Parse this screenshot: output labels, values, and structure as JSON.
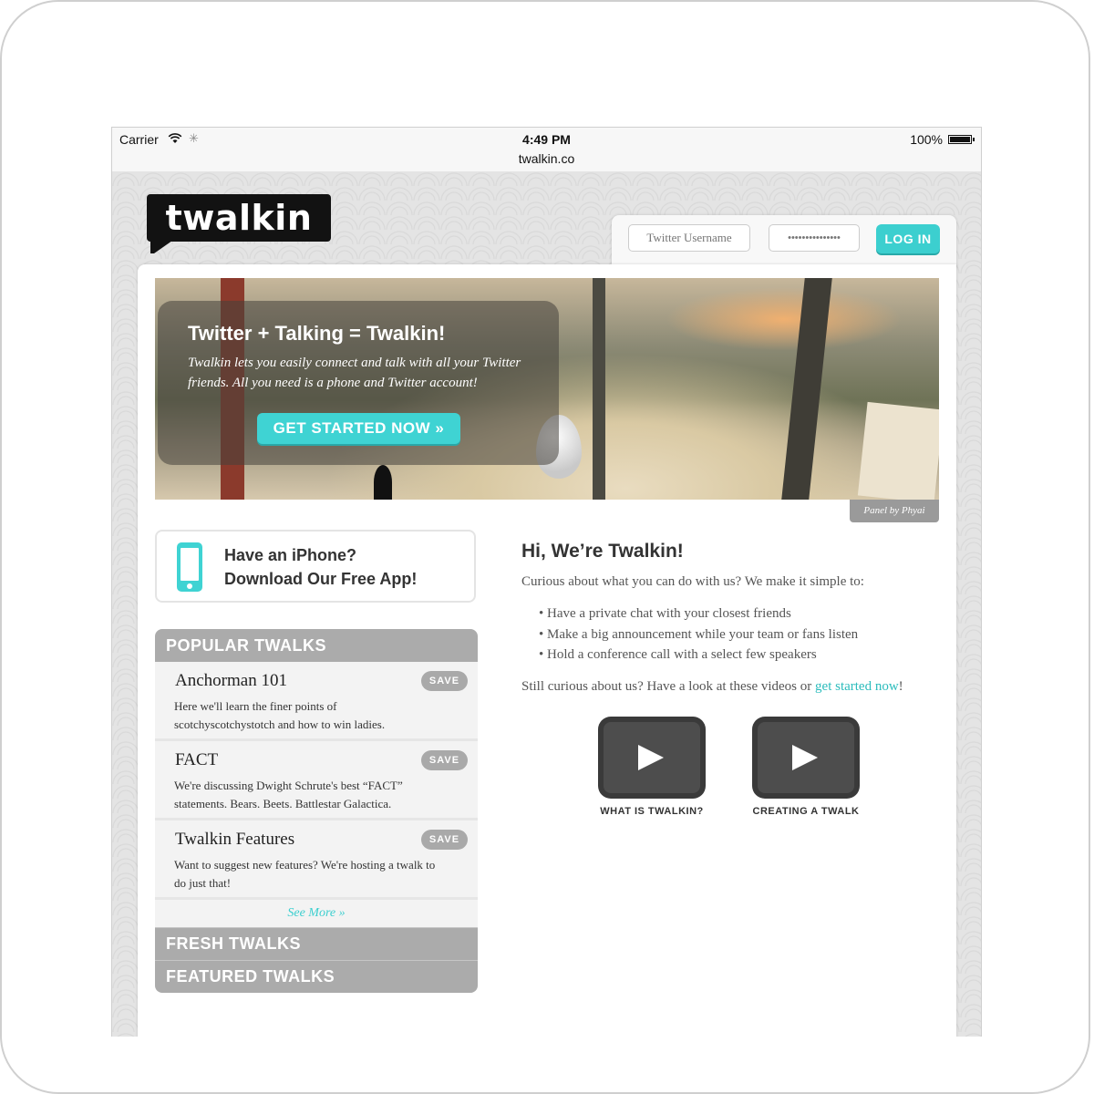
{
  "statusbar": {
    "carrier": "Carrier",
    "time": "4:49 PM",
    "url": "twalkin.co",
    "battery": "100%"
  },
  "site": {
    "logo": "twalkin",
    "login": {
      "username_placeholder": "Twitter Username",
      "password_mask": "•••••••••••••••",
      "button": "LOG IN"
    },
    "hero": {
      "title": "Twitter + Talking = Twalkin!",
      "text": "Twalkin lets you easily connect and talk with all your Twitter friends. All you need is a phone and Twitter account!",
      "button": "GET STARTED NOW »",
      "credit": "Panel by Phyai"
    },
    "app_promo": {
      "line1": "Have an iPhone?",
      "line2": "Download Our Free App!"
    },
    "popular": {
      "heading": "POPULAR TWALKS",
      "items": [
        {
          "title": "Anchorman 101",
          "desc": "Here we'll learn the finer points of scotchyscotchystotch and how to win ladies.",
          "save": "SAVE"
        },
        {
          "title": "FACT",
          "desc": "We're discussing Dwight Schrute's best “FACT” statements. Bears. Beets. Battlestar Galactica.",
          "save": "SAVE"
        },
        {
          "title": "Twalkin Features",
          "desc": "Want to suggest new features? We're hosting a twalk to do just that!",
          "save": "SAVE"
        }
      ],
      "see_more": "See More »"
    },
    "fresh_heading": "FRESH TWALKS",
    "featured_heading": "FEATURED TWALKS",
    "intro": {
      "title": "Hi, We’re Twalkin!",
      "text": "Curious about what you can do with us? We make it simple to:",
      "bullets": [
        "Have a private chat with your closest friends",
        "Make a big announcement while your team or fans listen",
        "Hold a conference call with a select few speakers"
      ],
      "curious_prefix": "Still curious about us? Have a look at these videos or ",
      "curious_link": "get started now",
      "curious_suffix": "!"
    },
    "videos": [
      {
        "label": "WHAT IS TWALKIN?"
      },
      {
        "label": "CREATING A TWALK"
      }
    ]
  },
  "colors": {
    "accent": "#3ccfcf",
    "panel_header": "#ababab"
  }
}
